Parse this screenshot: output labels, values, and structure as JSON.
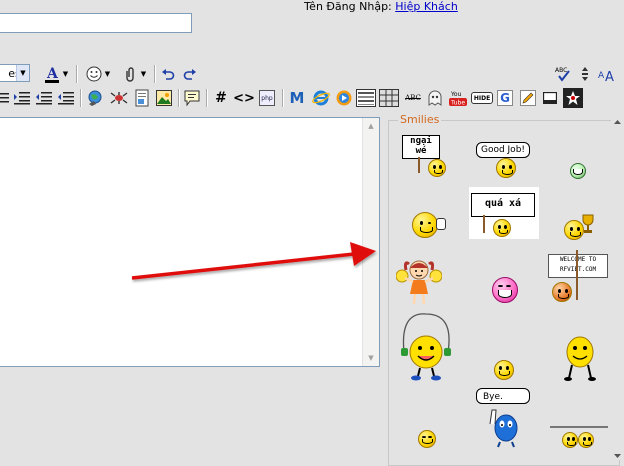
{
  "header": {
    "login_label": "Tên Đăng Nhập:",
    "login_user": "Hiệp Khách",
    "title_value": ""
  },
  "toolbar": {
    "font_value": "es",
    "row1_icons": [
      "font-color-icon",
      "smiley-icon",
      "attachment-icon",
      "undo-icon",
      "redo-icon",
      "spellcheck-icon",
      "resize-icon",
      "text-size-icon"
    ],
    "row2_icons": [
      "align-icon",
      "indent-icon",
      "outdent-icon",
      "link-icon",
      "unlink-icon",
      "insert-page-icon",
      "insert-image-icon",
      "quote-icon",
      "hash-icon",
      "code-icon",
      "php-icon",
      "gmail-icon",
      "ie-icon",
      "media-icon",
      "marquee-icon",
      "grid-icon",
      "abc-icon",
      "ghost-icon",
      "youtube-icon",
      "hide-icon",
      "google-icon",
      "pencil-icon",
      "box-icon",
      "star-icon"
    ],
    "abc_label": "ABC",
    "hide_label": "HIDE",
    "youtube_label": "You Tube",
    "hash_label": "#",
    "code_label": "<>",
    "php_label": "php",
    "gmail_label": "M",
    "google_label": "G",
    "spell_label": "ABC",
    "textsize_label": "AA"
  },
  "smilies": {
    "legend": "Smilies",
    "sign_ngai_line1": "ngại",
    "sign_ngai_line2": "wé",
    "bubble_good_job": "Good Job!",
    "sign_qua_xa": "quá xá",
    "welcome_line1": "WELCOME TO",
    "welcome_line2": "RFVIET.COM",
    "bubble_bye": "Bye."
  },
  "colors": {
    "accent": "#d2691e",
    "link": "#0000cc",
    "arrow": "#e01010",
    "smiley": "#ffd800"
  }
}
